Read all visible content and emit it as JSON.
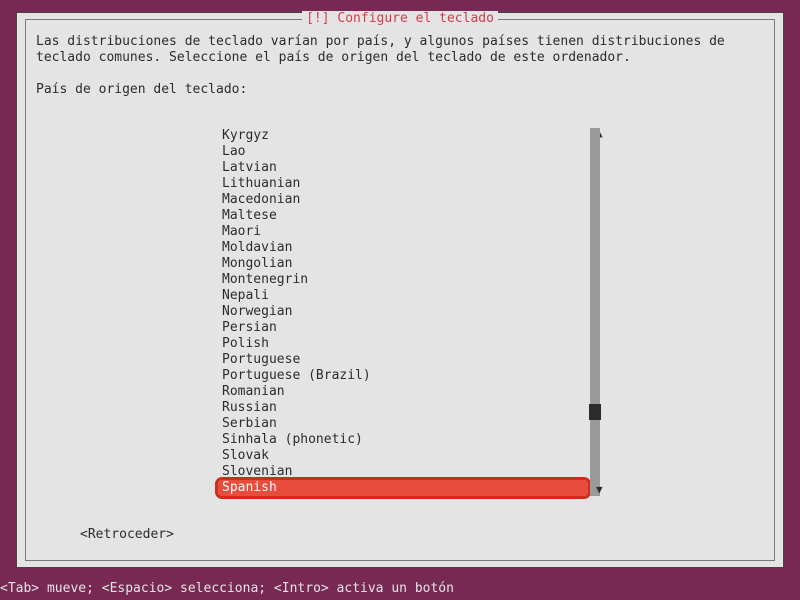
{
  "title": "[!] Configure el teclado",
  "description": "Las distribuciones de teclado varían por país, y algunos países tienen distribuciones de teclado comunes. Seleccione el país de origen del teclado de este ordenador.",
  "prompt": "País de origen del teclado:",
  "countries": [
    "Kyrgyz",
    "Lao",
    "Latvian",
    "Lithuanian",
    "Macedonian",
    "Maltese",
    "Maori",
    "Moldavian",
    "Mongolian",
    "Montenegrin",
    "Nepali",
    "Norwegian",
    "Persian",
    "Polish",
    "Portuguese",
    "Portuguese (Brazil)",
    "Romanian",
    "Russian",
    "Serbian",
    "Sinhala (phonetic)",
    "Slovak",
    "Slovenian",
    "Spanish"
  ],
  "selected_index": 22,
  "back_label": "<Retroceder>",
  "helpbar": "<Tab> mueve; <Espacio> selecciona; <Intro> activa un botón"
}
